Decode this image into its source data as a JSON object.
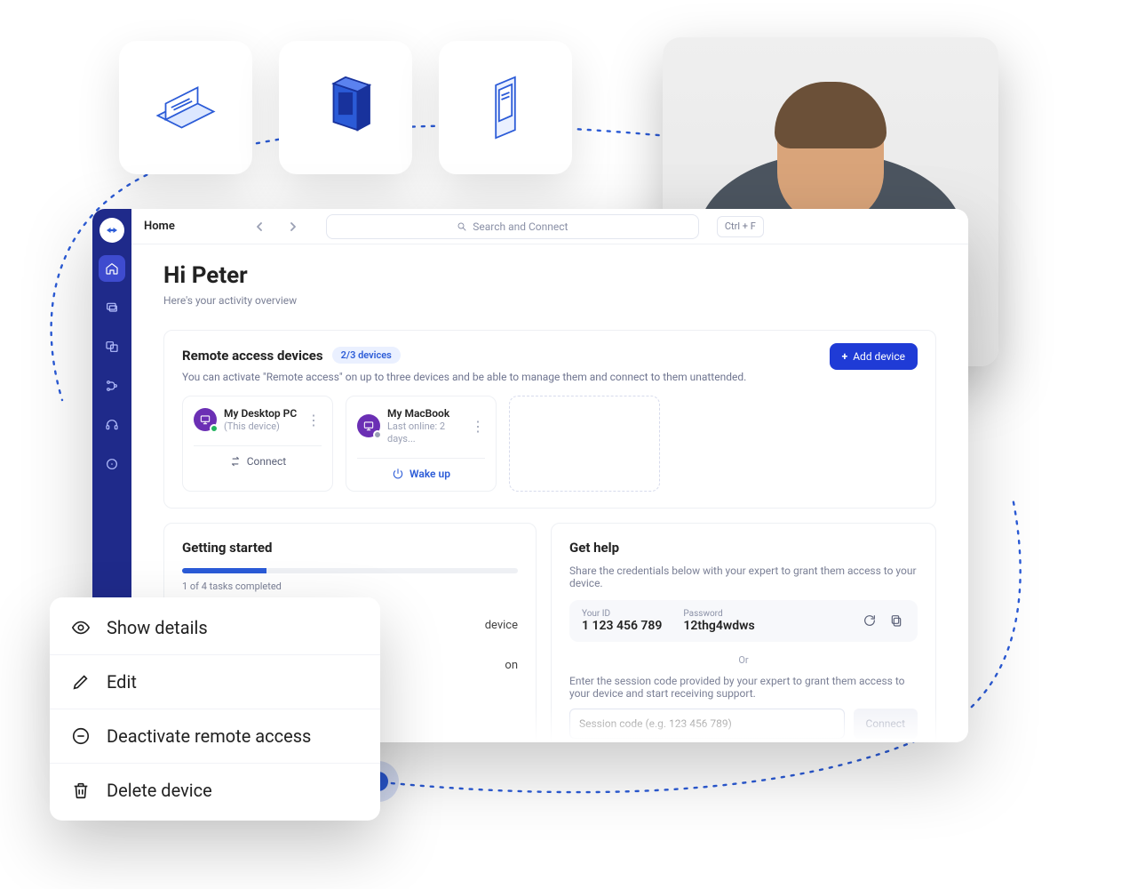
{
  "breadcrumb": "Home",
  "search": {
    "placeholder": "Search and Connect",
    "shortcut": "Ctrl + F"
  },
  "greeting": {
    "title": "Hi Peter",
    "subtitle": "Here's your activity overview"
  },
  "remote_access": {
    "title": "Remote access devices",
    "count_pill": "2/3 devices",
    "description": "You can activate \"Remote access\" on up to three devices and be able to manage them and connect to them unattended.",
    "add_button": "Add device",
    "devices": [
      {
        "name": "My Desktop PC",
        "subtitle": "(This device)",
        "action": "Connect",
        "action_type": "connect",
        "status": "online"
      },
      {
        "name": "My MacBook",
        "subtitle": "Last online: 2 days...",
        "action": "Wake up",
        "action_type": "wake",
        "status": "offline"
      }
    ]
  },
  "getting_started": {
    "title": "Getting started",
    "progress_label": "1 of 4 tasks completed",
    "progress_percent": 25,
    "lines": [
      "device",
      "on"
    ]
  },
  "get_help": {
    "title": "Get help",
    "share_text": "Share the credentials below with your expert to grant them access to your device.",
    "your_id_label": "Your ID",
    "your_id_value": "1 123 456 789",
    "password_label": "Password",
    "password_value": "12thg4wdws",
    "or": "Or",
    "session_text": "Enter the session code provided by your expert to grant them access to your device and start receiving support.",
    "session_placeholder": "Session code (e.g. 123 456 789)",
    "connect_label": "Connect"
  },
  "context_menu": {
    "show_details": "Show details",
    "edit": "Edit",
    "deactivate": "Deactivate remote access",
    "delete": "Delete device"
  }
}
